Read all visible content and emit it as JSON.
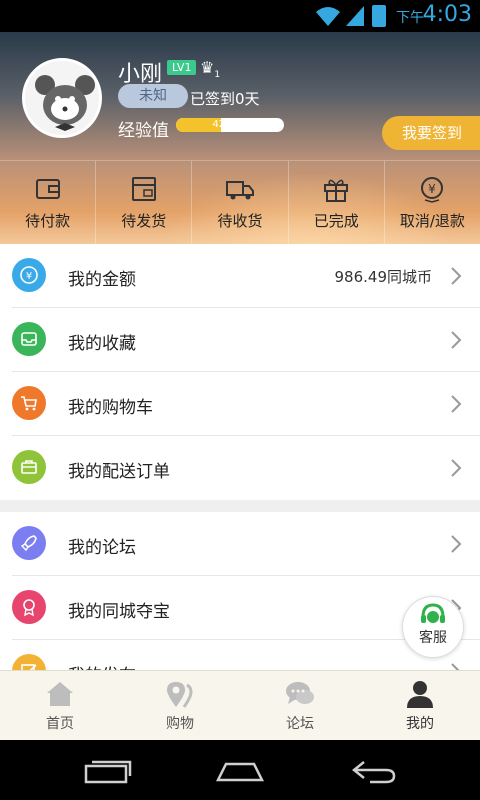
{
  "status_bar": {
    "ampm": "下午",
    "time": "4:03"
  },
  "profile": {
    "username": "小刚",
    "level": "LV1",
    "crown_count": "1",
    "badge": "未知",
    "signin_status": "已签到0天",
    "exp_label": "经验值",
    "exp_text": "42/100",
    "exp_progress": 0.42,
    "signin_button": "我要签到"
  },
  "orders": [
    {
      "label": "待付款",
      "icon": "wallet-icon"
    },
    {
      "label": "待发货",
      "icon": "box-icon"
    },
    {
      "label": "待收货",
      "icon": "truck-icon"
    },
    {
      "label": "已完成",
      "icon": "gift-icon"
    },
    {
      "label": "取消/退款",
      "icon": "refund-icon"
    }
  ],
  "menu_group1": [
    {
      "title": "我的金额",
      "value": "986.49同城币",
      "icon": "yuan-icon",
      "color": "#3aa9e8"
    },
    {
      "title": "我的收藏",
      "value": "",
      "icon": "inbox-icon",
      "color": "#3ab55a"
    },
    {
      "title": "我的购物车",
      "value": "",
      "icon": "cart-icon",
      "color": "#f0782a"
    },
    {
      "title": "我的配送订单",
      "value": "",
      "icon": "briefcase-icon",
      "color": "#8fc43a"
    }
  ],
  "menu_group2": [
    {
      "title": "我的论坛",
      "value": "",
      "icon": "rocket-icon",
      "color": "#7a7ef0"
    },
    {
      "title": "我的同城夺宝",
      "value": "",
      "icon": "medal-icon",
      "color": "#e8456e"
    },
    {
      "title": "我的发布",
      "value": "",
      "icon": "edit-icon",
      "color": "#f2b233"
    }
  ],
  "kefu": {
    "label": "客服"
  },
  "tabs": [
    {
      "label": "首页",
      "icon": "home-icon"
    },
    {
      "label": "购物",
      "icon": "location-icon"
    },
    {
      "label": "论坛",
      "icon": "chat-icon"
    },
    {
      "label": "我的",
      "icon": "user-icon"
    }
  ],
  "colors": {
    "accent": "#f0b435",
    "level_badge": "#3cc98d",
    "status_blue": "#35a8e0"
  }
}
